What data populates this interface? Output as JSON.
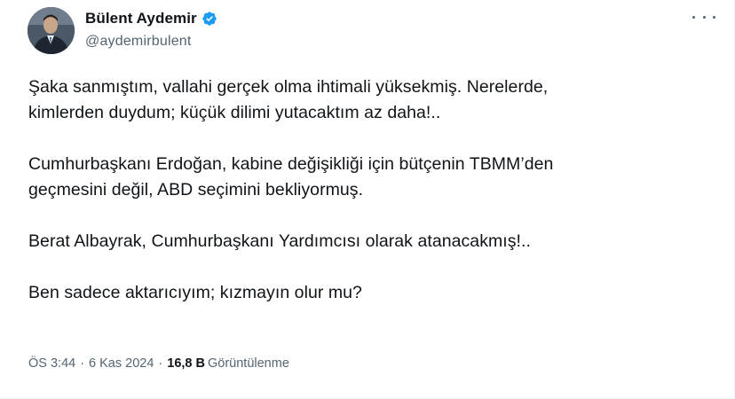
{
  "author": {
    "display_name": "Bülent Aydemir",
    "handle": "@aydemirbulent",
    "verified": true,
    "verified_color": "#1d9bf0"
  },
  "icons": {
    "verified": "verified-badge-icon",
    "more": "more-horizontal-icon"
  },
  "tweet": {
    "paragraphs": [
      "Şaka sanmıştım, vallahi gerçek olma ihtimali yüksekmiş. Nerelerde,\nkimlerden duydum; küçük dilimi yutacaktım az daha!..",
      "Cumhurbaşkanı Erdoğan, kabine değişikliği için bütçenin TBMM’den\ngeçmesini değil, ABD seçimini bekliyormuş.",
      "Berat Albayrak, Cumhurbaşkanı Yardımcısı olarak atanacakmış!..",
      "Ben sadece aktarıcıyım; kızmayın olur mu?"
    ]
  },
  "meta": {
    "time": "ÖS 3:44",
    "separator": "·",
    "date": "6 Kas 2024",
    "views_count": "16,8 B",
    "views_label": "Görüntülenme"
  }
}
